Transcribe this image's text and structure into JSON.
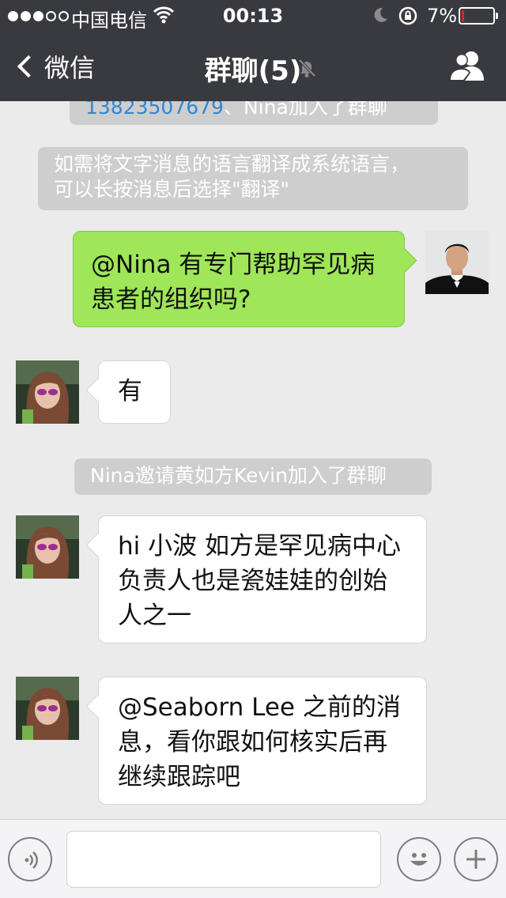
{
  "status_bar": {
    "carrier": "中国电信",
    "time": "00:13",
    "battery_percent_label": "7%",
    "battery_level": 0.07,
    "signal_bars_filled": 3,
    "signal_bars_total": 5
  },
  "nav": {
    "back_label": "微信",
    "title": "群聊(5)"
  },
  "messages": {
    "sys_join_contact": "13823507679",
    "sys_join_rest": "、Nina加入了群聊",
    "sys_translate_line1": "如需将文字消息的语言翻译成系统语言，",
    "sys_translate_line2": "可以长按消息后选择\"翻译\"",
    "msg_me_line1": "@Nina 有专门帮助罕见病",
    "msg_me_line2": "患者的组织吗?",
    "msg_nina_1": "有",
    "sys_invite": "Nina邀请黄如方Kevin加入了群聊",
    "msg_nina_2_line1": "hi 小波 如方是罕见病中心",
    "msg_nina_2_line2": "负责人也是瓷娃娃的创始",
    "msg_nina_2_line3": "人之一",
    "msg_nina_3_line1": "@Seaborn Lee 之前的消",
    "msg_nina_3_line2": "息，看你跟如何核实后再",
    "msg_nina_3_line3": "继续跟踪吧"
  },
  "input": {
    "value": "",
    "placeholder": ""
  },
  "icons": {
    "back": "chevron-left-icon",
    "mute": "mute-bell-icon",
    "group": "group-members-icon",
    "voice": "voice-icon",
    "emoji": "emoji-icon",
    "plus": "plus-icon"
  },
  "colors": {
    "nav_bg": "#393a3f",
    "chat_bg": "#ebebeb",
    "my_bubble": "#9fe658",
    "other_bubble": "#ffffff",
    "system_bubble": "#cecece",
    "link": "#2f87d6"
  }
}
